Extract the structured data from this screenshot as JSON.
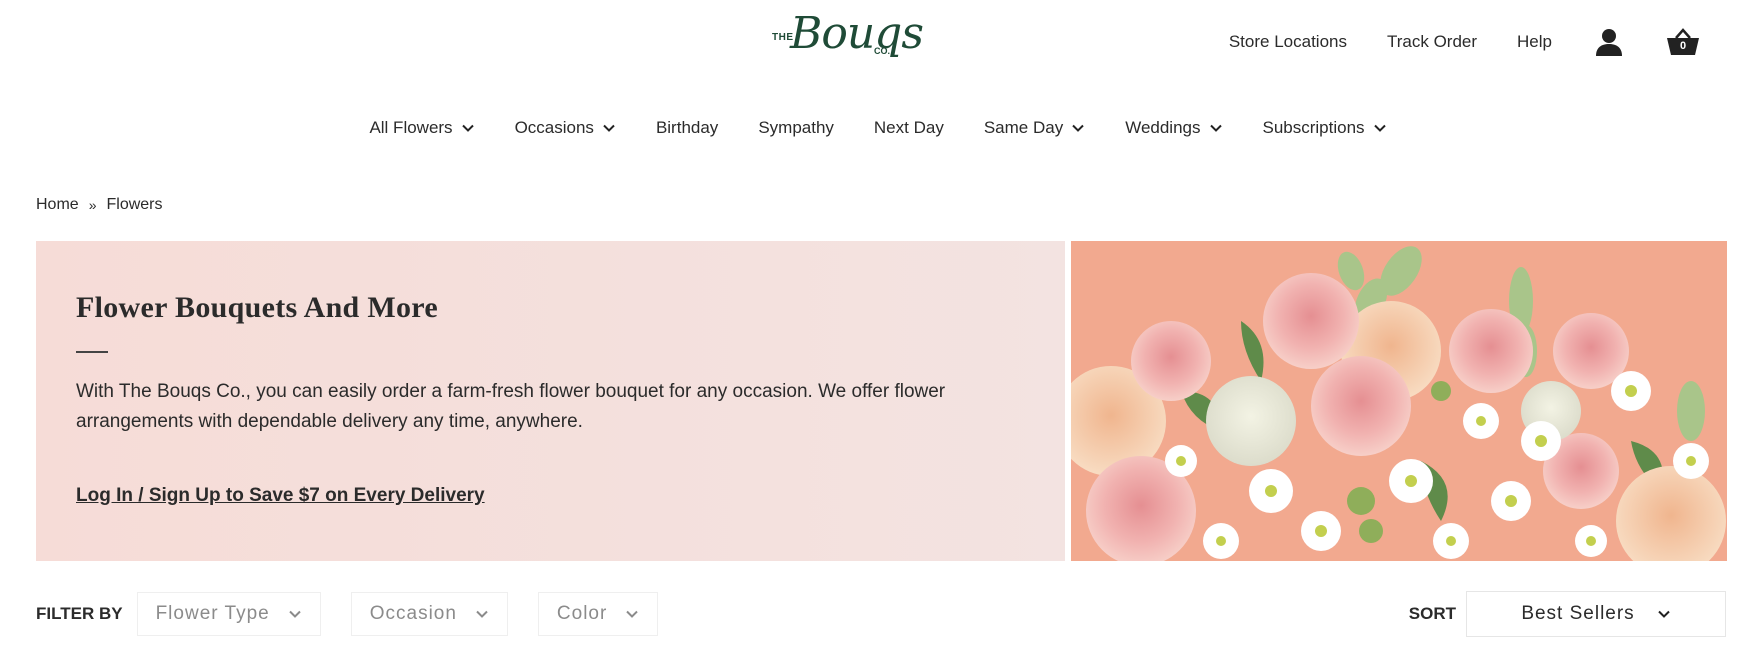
{
  "header": {
    "logo": {
      "the": "THE",
      "script": "Bouqs",
      "co": "CO."
    },
    "utility_links": [
      "Store Locations",
      "Track Order",
      "Help"
    ],
    "cart_count": "0"
  },
  "nav": {
    "items": [
      {
        "label": "All Flowers",
        "has_dropdown": true
      },
      {
        "label": "Occasions",
        "has_dropdown": true
      },
      {
        "label": "Birthday",
        "has_dropdown": false
      },
      {
        "label": "Sympathy",
        "has_dropdown": false
      },
      {
        "label": "Next Day",
        "has_dropdown": false
      },
      {
        "label": "Same Day",
        "has_dropdown": true
      },
      {
        "label": "Weddings",
        "has_dropdown": true
      },
      {
        "label": "Subscriptions",
        "has_dropdown": true
      }
    ]
  },
  "breadcrumb": {
    "home": "Home",
    "separator": "»",
    "current": "Flowers"
  },
  "hero": {
    "title": "Flower Bouquets And More",
    "description": "With The Bouqs Co., you can easily order a farm-fresh flower bouquet for any occasion. We offer flower arrangements with dependable delivery any time, anywhere.",
    "cta": "Log In / Sign Up to Save $7 on Every Delivery"
  },
  "filters": {
    "label": "FILTER BY",
    "options": [
      "Flower Type",
      "Occasion",
      "Color"
    ]
  },
  "sort": {
    "label": "SORT",
    "selected": "Best Sellers"
  },
  "colors": {
    "brand_green": "#1f4b37",
    "hero_bg": "#f6dcd7",
    "image_bg": "#f2a98f"
  },
  "icons": [
    "account-icon",
    "cart-icon",
    "chevron-down-icon"
  ]
}
